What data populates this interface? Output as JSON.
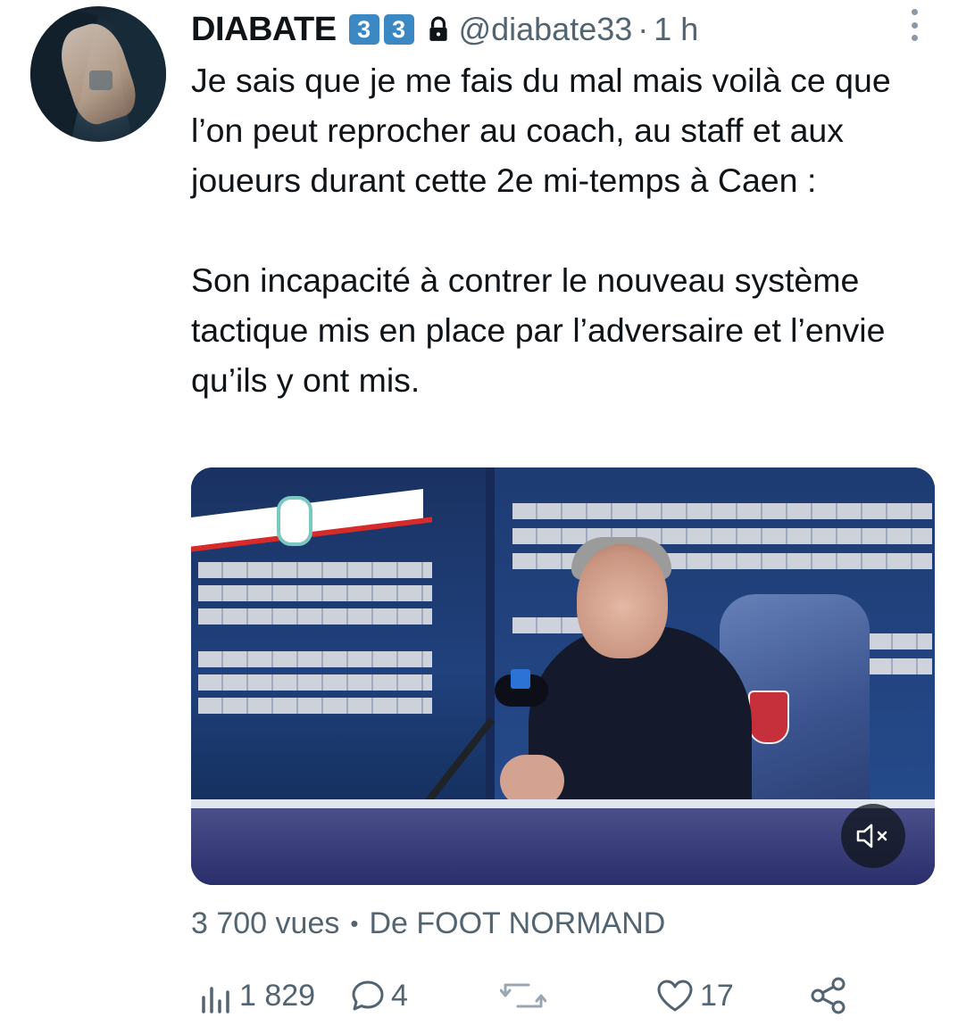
{
  "tweet": {
    "author": {
      "name": "DIABATE",
      "emoji_badges": [
        "3",
        "3"
      ],
      "handle": "@diabate33",
      "time": "1 h",
      "separator": "·"
    },
    "text": {
      "paragraph1": "Je sais que je me fais du mal mais voilà ce que l’on peut reprocher au coach, au staff et aux joueurs durant cette 2e mi-temps à Caen :",
      "paragraph2": "Son incapacité à contrer le nouveau système tactique mis en place par l’adversaire et l’envie qu’ils y ont mis."
    },
    "media": {
      "type": "video",
      "muted": true
    },
    "meta": {
      "views": "3 700 vues",
      "separator": "•",
      "source": "De FOOT NORMAND"
    },
    "actions": {
      "views_count": "1 829",
      "replies_count": "4",
      "retweets_count": "",
      "likes_count": "17"
    }
  },
  "icons": {
    "lock": "lock-icon",
    "more": "more-icon",
    "mute": "volume-muted-icon",
    "views": "analytics-icon",
    "reply": "reply-icon",
    "retweet": "retweet-icon",
    "like": "heart-icon",
    "share": "share-icon"
  },
  "colors": {
    "text": "#0f1419",
    "secondary": "#536471",
    "badge_blue": "#3b88c3"
  }
}
